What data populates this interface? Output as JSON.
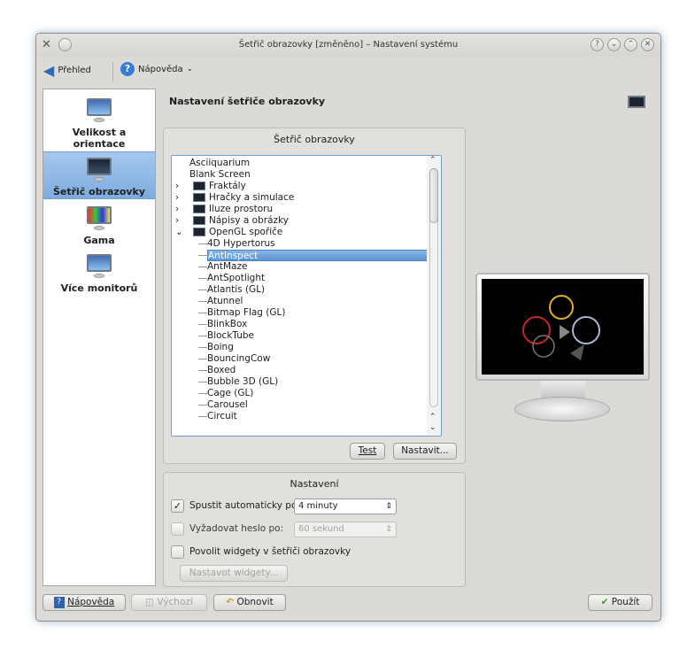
{
  "window": {
    "title": "Šetřič obrazovky [změněno] – Nastavení systému"
  },
  "toolbar": {
    "overview": "Přehled",
    "help": "Nápověda"
  },
  "sidebar": {
    "items": [
      {
        "label": "Velikost a orientace",
        "active": false
      },
      {
        "label": "Šetřič obrazovky",
        "active": true
      },
      {
        "label": "Gama",
        "active": false
      },
      {
        "label": "Více monitorů",
        "active": false
      }
    ]
  },
  "main": {
    "title": "Nastavení šetřiče obrazovky",
    "saver_group_title": "Šetřič obrazovky",
    "tree": [
      {
        "label": "Asciiquarium",
        "level": 0,
        "expander": ""
      },
      {
        "label": "Blank Screen",
        "level": 0,
        "expander": ""
      },
      {
        "label": "Fraktály",
        "level": 0,
        "expander": ">"
      },
      {
        "label": "Hračky a simulace",
        "level": 0,
        "expander": ">"
      },
      {
        "label": "Iluze prostoru",
        "level": 0,
        "expander": ">"
      },
      {
        "label": "Nápisy a obrázky",
        "level": 0,
        "expander": ">"
      },
      {
        "label": "OpenGL spořiče",
        "level": 0,
        "expander": "v"
      },
      {
        "label": "4D Hypertorus",
        "level": 1
      },
      {
        "label": "AntInspect",
        "level": 1,
        "selected": true
      },
      {
        "label": "AntMaze",
        "level": 1
      },
      {
        "label": "AntSpotlight",
        "level": 1
      },
      {
        "label": "Atlantis (GL)",
        "level": 1
      },
      {
        "label": "Atunnel",
        "level": 1
      },
      {
        "label": "Bitmap Flag (GL)",
        "level": 1
      },
      {
        "label": "BlinkBox",
        "level": 1
      },
      {
        "label": "BlockTube",
        "level": 1
      },
      {
        "label": "Boing",
        "level": 1
      },
      {
        "label": "BouncingCow",
        "level": 1
      },
      {
        "label": "Boxed",
        "level": 1
      },
      {
        "label": "Bubble 3D (GL)",
        "level": 1
      },
      {
        "label": "Cage (GL)",
        "level": 1
      },
      {
        "label": "Carousel",
        "level": 1
      },
      {
        "label": "Circuit",
        "level": 1
      }
    ],
    "test_button": "Test",
    "setup_button": "Nastavit...",
    "settings_group_title": "Nastavení",
    "autostart": {
      "label": "Spustit automaticky po:",
      "checked": true,
      "value": "4 minuty"
    },
    "password": {
      "label": "Vyžadovat heslo po:",
      "checked": false,
      "value": "60 sekund"
    },
    "widgets": {
      "label": "Povolit widgety v šetřiči obrazovky",
      "checked": false
    },
    "widgets_button": "Nastavot widgety..."
  },
  "bottom": {
    "help": "Nápověda",
    "defaults": "Výchozí",
    "reset": "Obnovit",
    "apply": "Použít"
  },
  "colors": {
    "selection": "#5d95d6",
    "window_bg": "#dcdad7"
  }
}
